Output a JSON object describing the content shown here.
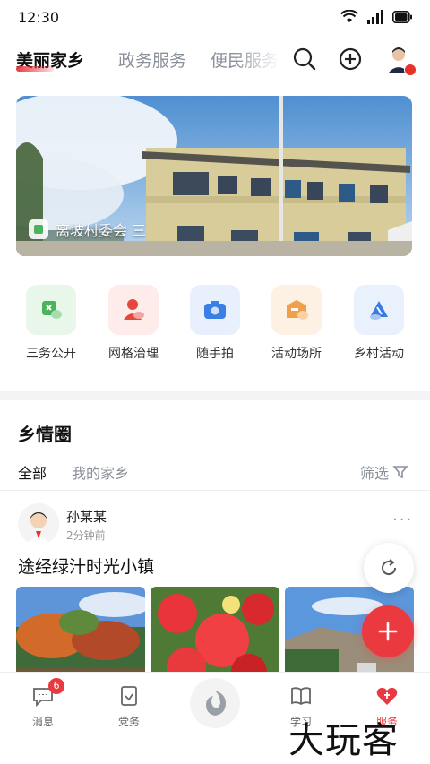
{
  "status_bar": {
    "time": "12:30"
  },
  "top_tabs": [
    {
      "label": "美丽家乡",
      "active": true
    },
    {
      "label": "政务服务",
      "active": false
    },
    {
      "label": "便民服务",
      "active": false
    }
  ],
  "banner": {
    "caption": "离坡村委会 三"
  },
  "quick_actions": [
    {
      "label": "三务公开",
      "icon": "party-flag-icon",
      "bg": "#e9f6ea",
      "fg": "#4bb35c"
    },
    {
      "label": "网格治理",
      "icon": "person-icon",
      "bg": "#fdecea",
      "fg": "#e5463e"
    },
    {
      "label": "随手拍",
      "icon": "camera-icon",
      "bg": "#e7f0fc",
      "fg": "#3a7ee6"
    },
    {
      "label": "活动场所",
      "icon": "venue-icon",
      "bg": "#fdf1e4",
      "fg": "#f0a04a"
    },
    {
      "label": "乡村活动",
      "icon": "activity-icon",
      "bg": "#e9f1fd",
      "fg": "#3b79e3"
    }
  ],
  "feed": {
    "title": "乡情圈",
    "tabs": [
      {
        "label": "全部",
        "active": true
      },
      {
        "label": "我的家乡",
        "active": false
      }
    ],
    "filter_label": "筛选",
    "post": {
      "user": "孙某某",
      "time": "2分钟前",
      "text": "途经绿汁时光小镇"
    }
  },
  "bottom_nav": [
    {
      "label": "消息",
      "badge": "6"
    },
    {
      "label": "党务"
    },
    {
      "label": "学习"
    },
    {
      "label": "服务",
      "active": true
    }
  ],
  "watermark": "大玩客",
  "colors": {
    "accent": "#ea3a3f"
  }
}
